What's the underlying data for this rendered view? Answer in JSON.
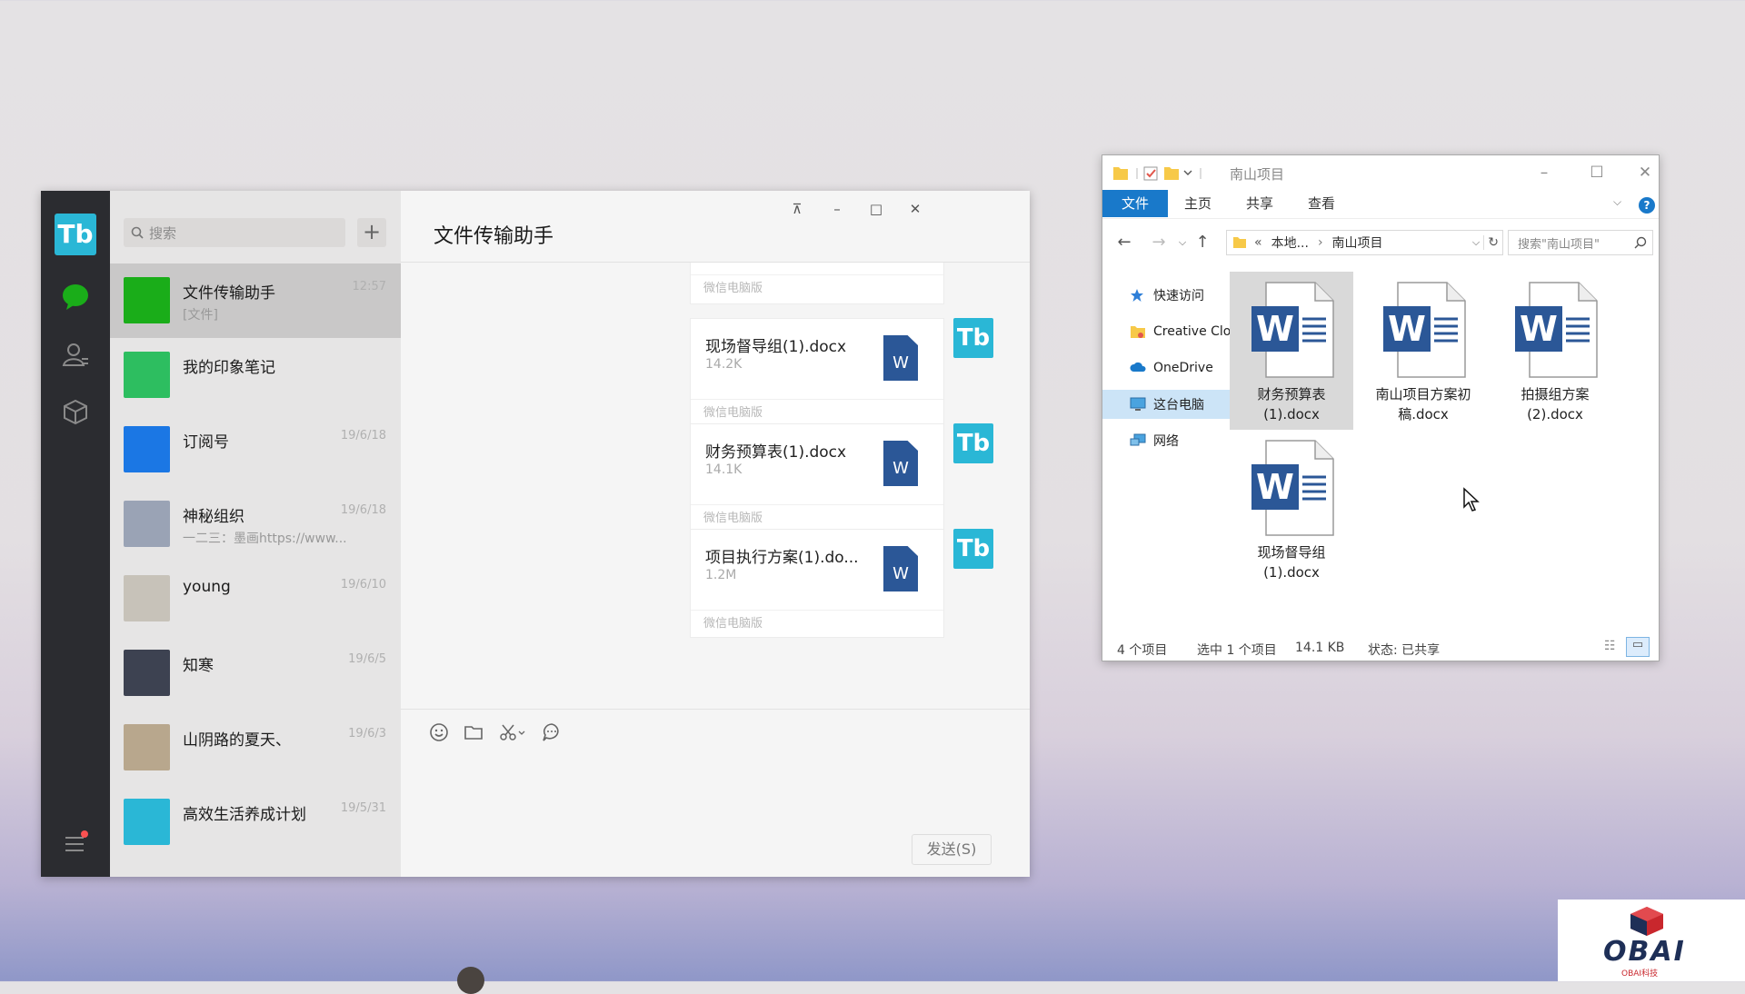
{
  "wechat": {
    "rail_avatar": "Tb",
    "search_placeholder": "搜索",
    "add_label": "+",
    "chats": [
      {
        "name": "文件传输助手",
        "sub": "[文件]",
        "time": "12:57",
        "active": true,
        "avatar_color": "#1aad19"
      },
      {
        "name": "我的印象笔记",
        "sub": "",
        "time": "",
        "avatar_color": "#2dbe60"
      },
      {
        "name": "订阅号",
        "sub": "",
        "time": "19/6/18",
        "avatar_color": "#1b77e4"
      },
      {
        "name": "神秘组织",
        "sub": "一二三：墨画https://www...",
        "time": "19/6/18",
        "avatar_color": "#9aa3b5"
      },
      {
        "name": "young",
        "sub": "",
        "time": "19/6/10",
        "avatar_color": "#c7c2b9"
      },
      {
        "name": "知寒",
        "sub": "",
        "time": "19/6/5",
        "avatar_color": "#3d4251"
      },
      {
        "name": "山阴路的夏天、",
        "sub": "",
        "time": "19/6/3",
        "avatar_color": "#b8a78d"
      },
      {
        "name": "高效生活养成计划",
        "sub": "",
        "time": "19/5/31",
        "avatar_color": "#2ab7d6"
      }
    ],
    "chat_title": "文件传输助手",
    "controls": {
      "pin": "⊼",
      "min": "–",
      "max": "□",
      "close": "✕"
    },
    "messages": [
      {
        "name": "现场督导组(1).docx",
        "size": "14.2K",
        "source": "微信电脑版"
      },
      {
        "name": "财务预算表(1).docx",
        "size": "14.1K",
        "source": "微信电脑版"
      },
      {
        "name": "项目执行方案(1).do...",
        "size": "1.2M",
        "source": "微信电脑版"
      }
    ],
    "partial_source": "微信电脑版",
    "file_icon_letter": "W",
    "send_label": "发送(S)"
  },
  "explorer": {
    "title": "南山项目",
    "tabs": [
      "文件",
      "主页",
      "共享",
      "查看"
    ],
    "address_root": "本地...",
    "address_folder": "南山项目",
    "search_placeholder": "搜索\"南山项目\"",
    "nav": [
      "快速访问",
      "Creative Clo",
      "OneDrive",
      "这台电脑",
      "网络"
    ],
    "files": [
      {
        "label1": "财务预算表",
        "label2": "(1).docx",
        "selected": true
      },
      {
        "label1": "南山项目方案初",
        "label2": "稿.docx",
        "selected": false
      },
      {
        "label1": "拍摄组方案",
        "label2": "(2).docx",
        "selected": false
      },
      {
        "label1": "现场督导组",
        "label2": "(1).docx",
        "selected": false
      }
    ],
    "status_count": "4 个项目",
    "status_selected": "选中 1 个项目",
    "status_size": "14.1 KB",
    "status_share": "状态: 已共享",
    "accent": "#1979ca"
  },
  "logo": {
    "text": "OBAI",
    "sub": "OBAI科技"
  }
}
